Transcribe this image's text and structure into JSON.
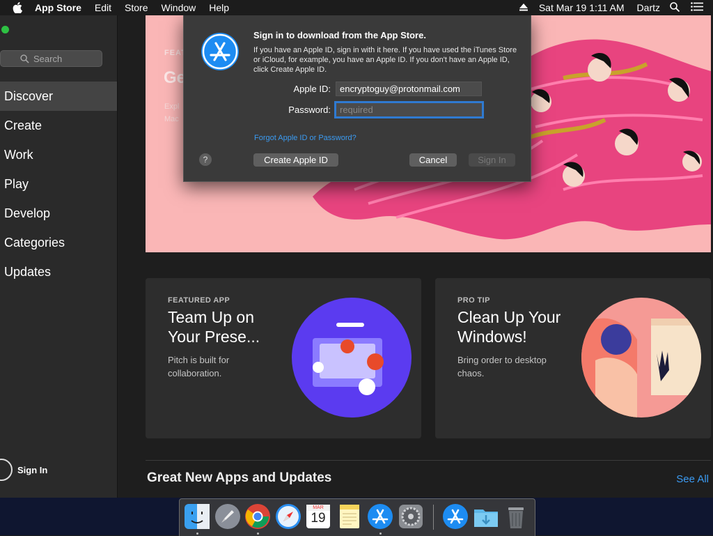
{
  "menubar": {
    "app_name": "App Store",
    "menus": [
      "Edit",
      "Store",
      "Window",
      "Help"
    ],
    "datetime": "Sat Mar 19  1:11 AM",
    "user": "Dartz"
  },
  "sidebar": {
    "search_placeholder": "Search",
    "items": [
      {
        "label": "Discover",
        "active": true
      },
      {
        "label": "Create"
      },
      {
        "label": "Work"
      },
      {
        "label": "Play"
      },
      {
        "label": "Develop"
      },
      {
        "label": "Categories"
      },
      {
        "label": "Updates"
      }
    ],
    "sign_in": "Sign In"
  },
  "hero": {
    "eyebrow": "FEAT",
    "title": "Ge",
    "sub_line1": "Expl",
    "sub_line2": "Mac"
  },
  "cards": [
    {
      "eyebrow": "FEATURED APP",
      "title": "Team Up on Your Prese...",
      "desc": "Pitch is built for collaboration.",
      "art_color": "#5b3bf0"
    },
    {
      "eyebrow": "PRO TIP",
      "title": "Clean Up Your Windows!",
      "desc": "Bring order to desktop chaos.",
      "art_color": "#f59a95"
    }
  ],
  "section": {
    "title": "Great New Apps and Updates",
    "see_all": "See All"
  },
  "dialog": {
    "title": "Sign in to download from the App Store.",
    "body": "If you have an Apple ID, sign in with it here. If you have used the iTunes Store or iCloud, for example, you have an Apple ID. If you don't have an Apple ID, click Create Apple ID.",
    "apple_id_label": "Apple ID:",
    "apple_id_value": "encryptoguy@protonmail.com",
    "password_label": "Password:",
    "password_placeholder": "required",
    "forgot": "Forgot Apple ID or Password?",
    "help": "?",
    "create_btn": "Create Apple ID",
    "cancel_btn": "Cancel",
    "signin_btn": "Sign In"
  },
  "dock": {
    "calendar_month": "MAR",
    "calendar_day": "19"
  },
  "colors": {
    "accent": "#3b9bf2",
    "hero_bg": "#fab6b6",
    "appstore_blue": "#1d8cf2"
  }
}
